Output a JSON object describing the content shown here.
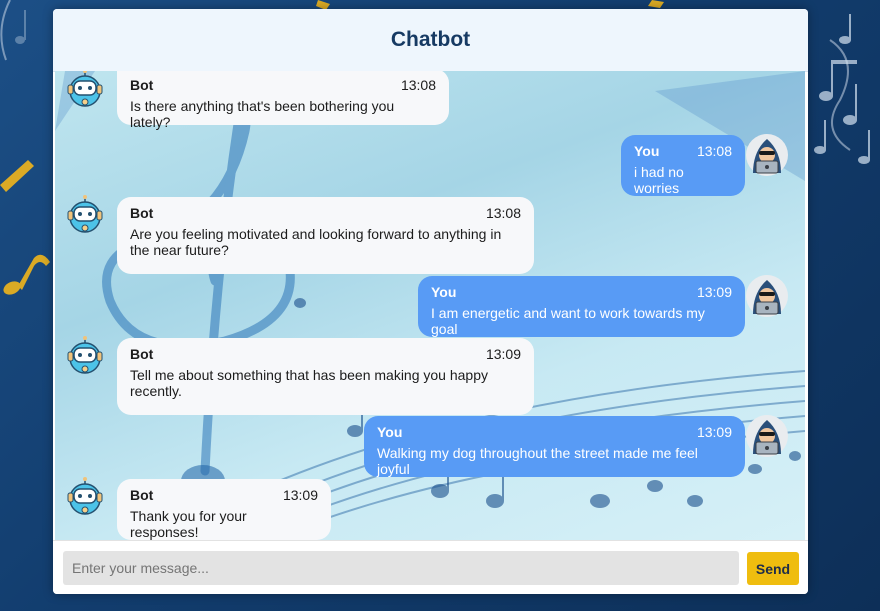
{
  "app": {
    "title": "Chatbot"
  },
  "colors": {
    "bot_bubble": "#f7f8fa",
    "user_bubble": "#589bf5",
    "send_button": "#efbd0f",
    "header_text": "#163a63"
  },
  "icons": {
    "bot_avatar": "robot-icon",
    "user_avatar": "hooded-hacker-icon"
  },
  "messages": [
    {
      "sender": "Bot",
      "time": "13:08",
      "text": "Is there anything that's been bothering you lately?"
    },
    {
      "sender": "You",
      "time": "13:08",
      "text": "i had no worries"
    },
    {
      "sender": "Bot",
      "time": "13:08",
      "text": "Are you feeling motivated and looking forward to anything in the near future?"
    },
    {
      "sender": "You",
      "time": "13:09",
      "text": "I am energetic and want to work towards my goal"
    },
    {
      "sender": "Bot",
      "time": "13:09",
      "text": "Tell me about something that has been making you happy recently."
    },
    {
      "sender": "You",
      "time": "13:09",
      "text": "Walking my dog throughout the street made me feel joyful"
    },
    {
      "sender": "Bot",
      "time": "13:09",
      "text": "Thank you for your responses!"
    }
  ],
  "input": {
    "placeholder": "Enter your message...",
    "value": ""
  },
  "send": {
    "label": "Send"
  }
}
